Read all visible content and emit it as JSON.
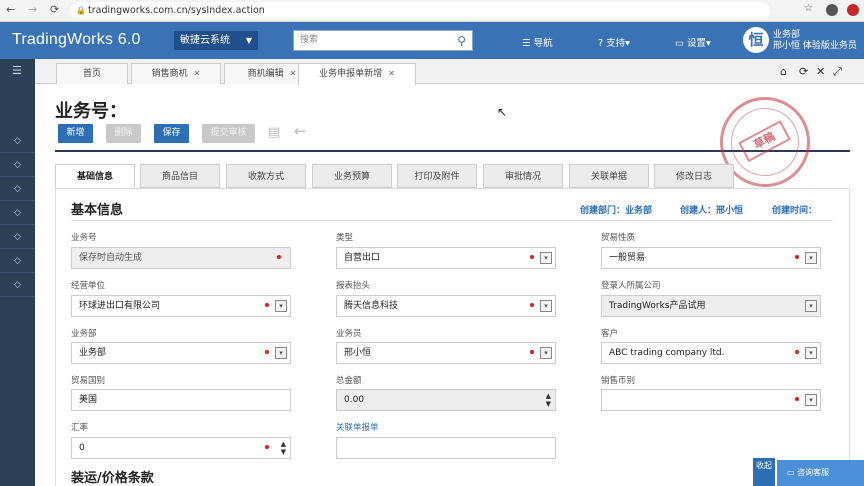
{
  "browser": {
    "url": "tradingworks.com.cn/sysIndex.action",
    "back": "←",
    "forward": "→",
    "reload": "⟳"
  },
  "header": {
    "logo": "TradingWorks 6.0",
    "system_select": "敏捷云系统",
    "search_placeholder": "搜索",
    "nav": "导航",
    "support": "支持",
    "settings": "设置",
    "avatar_glyph": "恒",
    "dept": "业务部",
    "user": "邢小恒",
    "role": "体验版业务员"
  },
  "page_tabs": [
    {
      "label": "首页"
    },
    {
      "label": "销售商机"
    },
    {
      "label": "商机编辑"
    },
    {
      "label": "业务申报单新增"
    }
  ],
  "title": "业务号：",
  "toolbar": {
    "new": "新增",
    "delete": "删除",
    "save": "保存",
    "submit": "提交审核"
  },
  "stamp": "草稿",
  "section_tabs": [
    "基础信息",
    "商品信目",
    "收款方式",
    "业务预算",
    "打印及附件",
    "审批情况",
    "关联单据",
    "修改日志"
  ],
  "basic": {
    "heading": "基本信息",
    "created_dept": "创建部门：业务部",
    "creator": "创建人：邢小恒",
    "created_time": "创建时间："
  },
  "fields": {
    "biz_no": {
      "label": "业务号",
      "value": "保存时自动生成"
    },
    "type": {
      "label": "类型",
      "value": "自营出口"
    },
    "trade_nature": {
      "label": "贸易性质",
      "value": "一般贸易"
    },
    "operator": {
      "label": "经营单位",
      "value": "环球进出口有限公司"
    },
    "letterhead": {
      "label": "报表抬头",
      "value": "腾天信息科技"
    },
    "login_company": {
      "label": "登录人所属公司",
      "value": "TradingWorks产品试用"
    },
    "department": {
      "label": "业务部",
      "value": "业务部"
    },
    "salesman": {
      "label": "业务员",
      "value": "邢小恒"
    },
    "customer": {
      "label": "客户",
      "value": "ABC trading company ltd."
    },
    "country": {
      "label": "贸易国别",
      "value": "美国"
    },
    "total": {
      "label": "总金额",
      "value": "0.00"
    },
    "currency": {
      "label": "销售币别",
      "value": ""
    },
    "rate": {
      "label": "汇率",
      "value": "0"
    },
    "related": {
      "label": "关联单报单",
      "value": ""
    }
  },
  "section2": "装运/价格条款",
  "float": {
    "collapse": "收起",
    "service": "咨询客服"
  }
}
